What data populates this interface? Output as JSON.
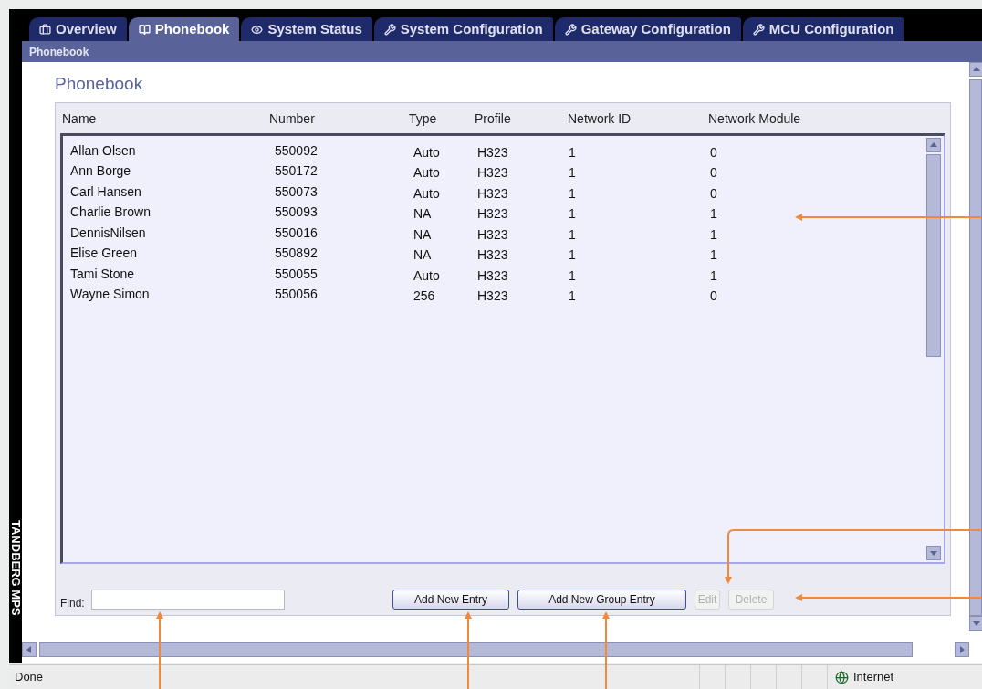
{
  "tabs": [
    {
      "label": "Overview",
      "selected": false
    },
    {
      "label": "Phonebook",
      "selected": true
    },
    {
      "label": "System Status",
      "selected": false
    },
    {
      "label": "System Configuration",
      "selected": false
    },
    {
      "label": "Gateway Configuration",
      "selected": false
    },
    {
      "label": "MCU Configuration",
      "selected": false
    }
  ],
  "breadcrumb": "Phonebook",
  "logo": "TANDBERG MPS",
  "page_title": "Phonebook",
  "table": {
    "columns": [
      "Name",
      "Number",
      "Type",
      "Profile",
      "Network ID",
      "Network Module"
    ],
    "rows": [
      [
        "Allan Olsen",
        "550092",
        "Auto",
        "H323",
        "1",
        "0"
      ],
      [
        "Ann Borge",
        "550172",
        "Auto",
        "H323",
        "1",
        "0"
      ],
      [
        "Carl Hansen",
        "550073",
        "Auto",
        "H323",
        "1",
        "0"
      ],
      [
        "Charlie Brown",
        "550093",
        "NA",
        "H323",
        "1",
        "1"
      ],
      [
        "DennisNilsen",
        "550016",
        "NA",
        "H323",
        "1",
        "1"
      ],
      [
        "Elise Green",
        "550892",
        "NA",
        "H323",
        "1",
        "1"
      ],
      [
        "Tami Stone",
        "550055",
        "Auto",
        "H323",
        "1",
        "1"
      ],
      [
        "Wayne Simon",
        "550056",
        "256",
        "H323",
        "1",
        "0"
      ]
    ]
  },
  "find": {
    "label": "Find:"
  },
  "buttons": [
    {
      "label": "Add New Entry",
      "disabled": false
    },
    {
      "label": "Add New Group Entry",
      "disabled": false
    },
    {
      "label": "Edit",
      "disabled": true
    },
    {
      "label": "Delete",
      "disabled": true
    }
  ],
  "status_bar": {
    "status": "Done",
    "zone": "Internet"
  }
}
